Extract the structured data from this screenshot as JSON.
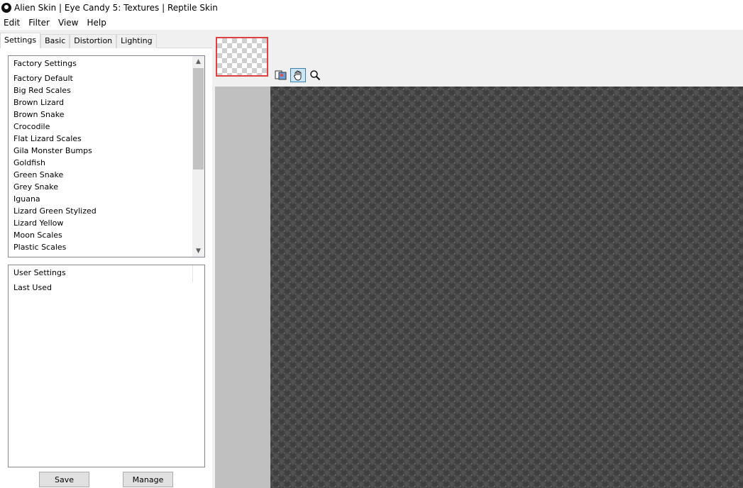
{
  "window": {
    "title": "Alien Skin | Eye Candy 5: Textures | Reptile Skin"
  },
  "menu": {
    "items": [
      "Edit",
      "Filter",
      "View",
      "Help"
    ]
  },
  "tabs": [
    {
      "label": "Settings",
      "active": true
    },
    {
      "label": "Basic",
      "active": false
    },
    {
      "label": "Distortion",
      "active": false
    },
    {
      "label": "Lighting",
      "active": false
    }
  ],
  "factory_settings": {
    "header": "Factory Settings",
    "items": [
      "Factory Default",
      "Big Red Scales",
      "Brown Lizard",
      "Brown Snake",
      "Crocodile",
      "Flat Lizard Scales",
      "Gila Monster Bumps",
      "Goldfish",
      "Green Snake",
      "Grey Snake",
      "Iguana",
      "Lizard Green Stylized",
      "Lizard Yellow",
      "Moon Scales",
      "Plastic Scales"
    ]
  },
  "user_settings": {
    "header": "User Settings",
    "items": [
      "Last Used"
    ]
  },
  "buttons": {
    "save": "Save",
    "manage": "Manage"
  },
  "toolbar": {
    "tools": [
      "preview-toggle-icon",
      "hand-icon",
      "zoom-icon"
    ],
    "active_tool": "hand-icon"
  },
  "colors": {
    "preview_border": "#e04040",
    "active_tool_border": "#3c7fb1"
  }
}
